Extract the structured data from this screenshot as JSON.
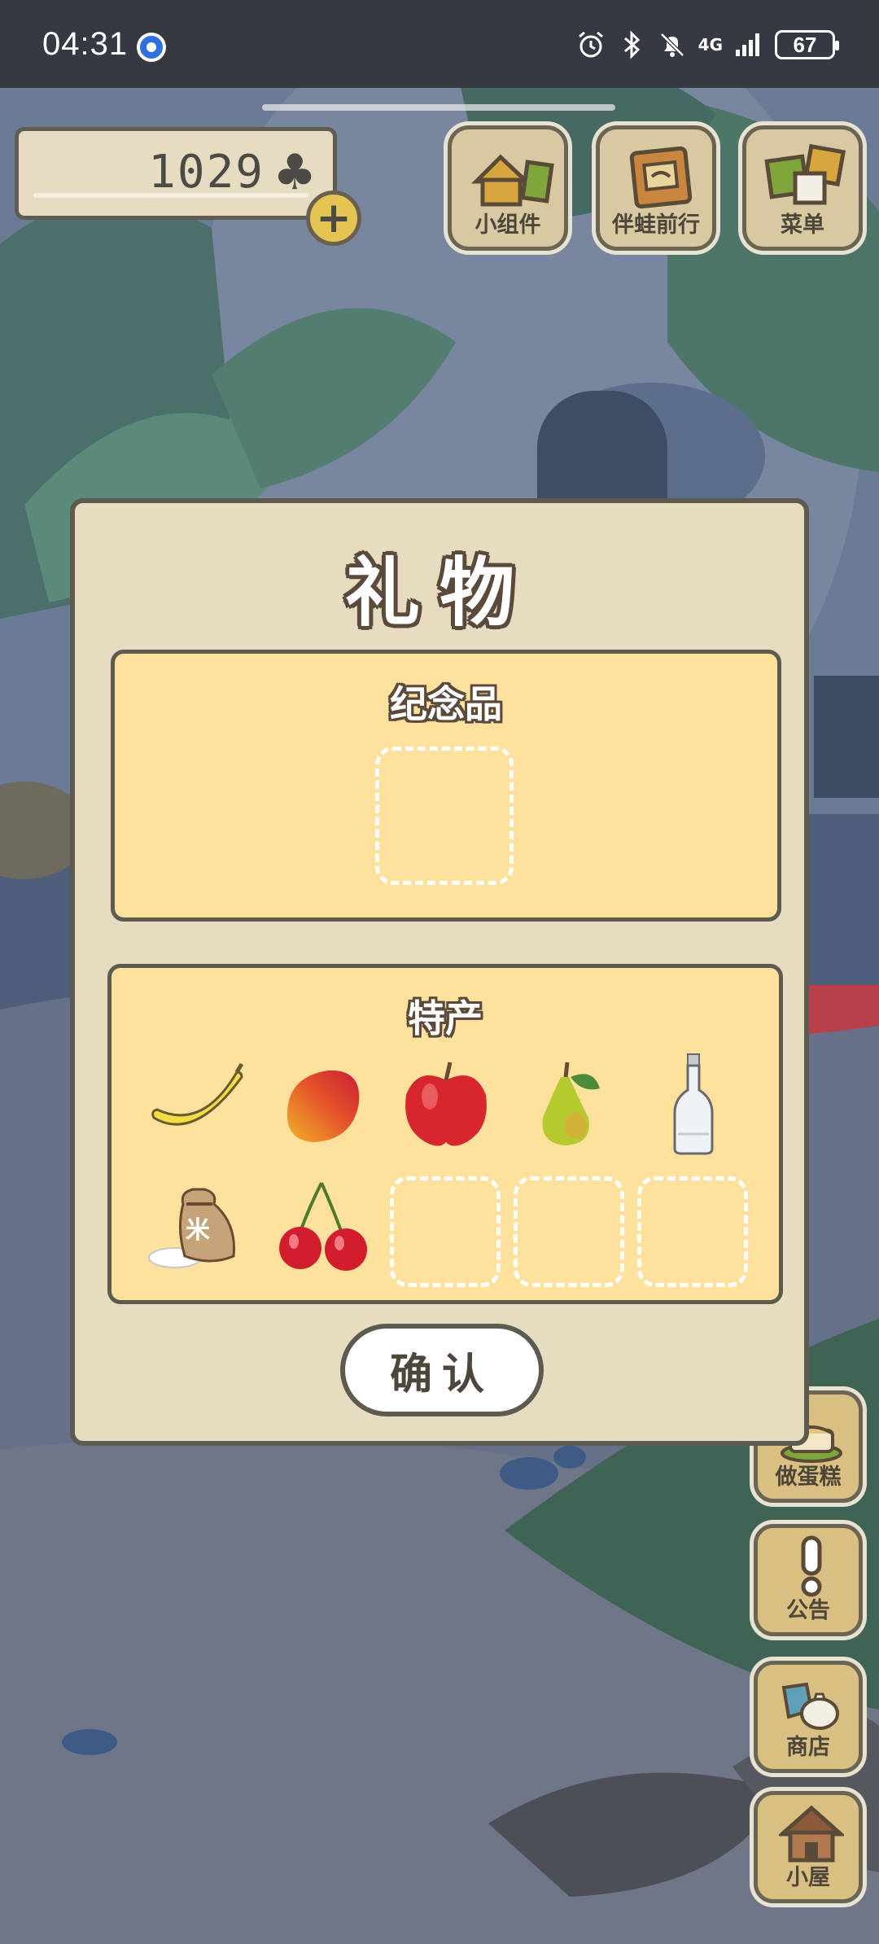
{
  "status_bar": {
    "time": "04:31",
    "network": "4G",
    "battery": "67"
  },
  "clovers": {
    "count": "1029",
    "symbol": "♣",
    "add_symbol": "+"
  },
  "top_buttons": [
    {
      "label": "小组件",
      "icon": "widget-icon"
    },
    {
      "label": "伴蛙前行",
      "icon": "journey-icon"
    },
    {
      "label": "菜单",
      "icon": "menu-icon"
    }
  ],
  "side_buttons": [
    {
      "label": "做蛋糕",
      "icon": "cake-icon"
    },
    {
      "label": "公告",
      "icon": "notice-icon"
    },
    {
      "label": "商店",
      "icon": "shop-icon"
    },
    {
      "label": "小屋",
      "icon": "house-icon"
    }
  ],
  "dialog": {
    "title": "礼物",
    "souvenir_title": "纪念品",
    "specialty_title": "特产",
    "confirm_label": "确认",
    "specialty_items": [
      {
        "icon": "banana-icon"
      },
      {
        "icon": "mango-icon"
      },
      {
        "icon": "apple-icon"
      },
      {
        "icon": "pear-icon"
      },
      {
        "icon": "bottle-icon"
      },
      {
        "icon": "rice-bag-icon",
        "text": "米"
      },
      {
        "icon": "cherry-icon"
      }
    ],
    "empty_specialty_slots": 3,
    "empty_souvenir_slots": 1
  },
  "colors": {
    "dialog_bg": "#e6dcc0",
    "section_bg": "#fde19c",
    "outline": "#5d5a4f",
    "coin": "#e6c451"
  }
}
